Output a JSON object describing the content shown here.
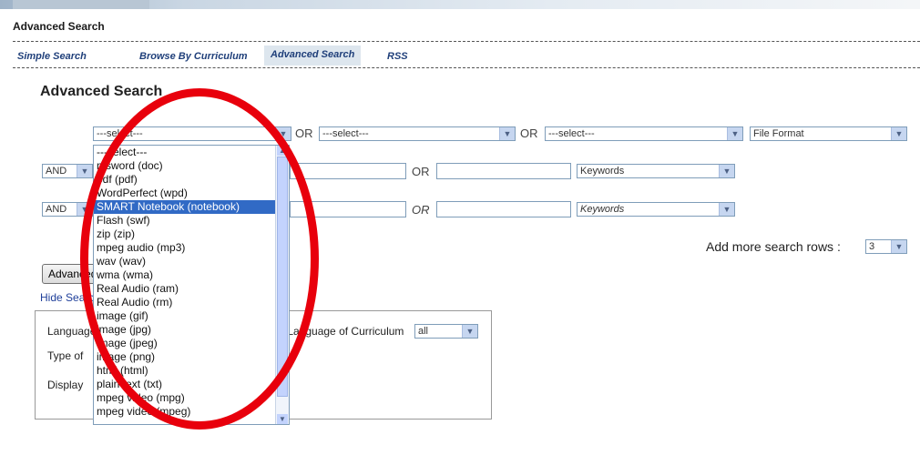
{
  "header": {
    "title": "Advanced Search"
  },
  "nav": {
    "items": [
      "Simple Search",
      "Browse By Curriculum",
      "Advanced Search",
      "RSS"
    ]
  },
  "page": {
    "title": "Advanced Search"
  },
  "row1": {
    "select1": "---select---",
    "or1": "OR",
    "select2": "---select---",
    "or2": "OR",
    "select3": "---select---",
    "format": "File Format"
  },
  "row2": {
    "bool": "AND",
    "or": "OR",
    "keywords": "Keywords"
  },
  "row3": {
    "bool": "AND",
    "or": "OR",
    "keywords": "Keywords"
  },
  "more_rows": {
    "label": "Add more search rows :",
    "value": "3"
  },
  "search_button": "Advanced Search",
  "hide_link": "Hide Search Options",
  "panel": {
    "language_label": "Language:",
    "language_curriculum_label": "Language of Curriculum:",
    "language_curriculum_value": "all",
    "type_label": "Type of",
    "display_label": "Display"
  },
  "dropdown": {
    "selected": "SMART Notebook (notebook)",
    "options": [
      "---select---",
      "msword (doc)",
      "pdf (pdf)",
      "WordPerfect (wpd)",
      "SMART Notebook (notebook)",
      "Flash (swf)",
      "zip (zip)",
      "mpeg audio (mp3)",
      "wav (wav)",
      "wma (wma)",
      "Real Audio (ram)",
      "Real Audio (rm)",
      "image (gif)",
      "image (jpg)",
      "image (jpeg)",
      "image (png)",
      "html (html)",
      "plain text (txt)",
      "mpeg video (mpg)",
      "mpeg video (mpeg)"
    ]
  },
  "colors": {
    "accent": "#316ac5",
    "annotation": "#e8000c",
    "nav_link": "#1f3f7a"
  }
}
